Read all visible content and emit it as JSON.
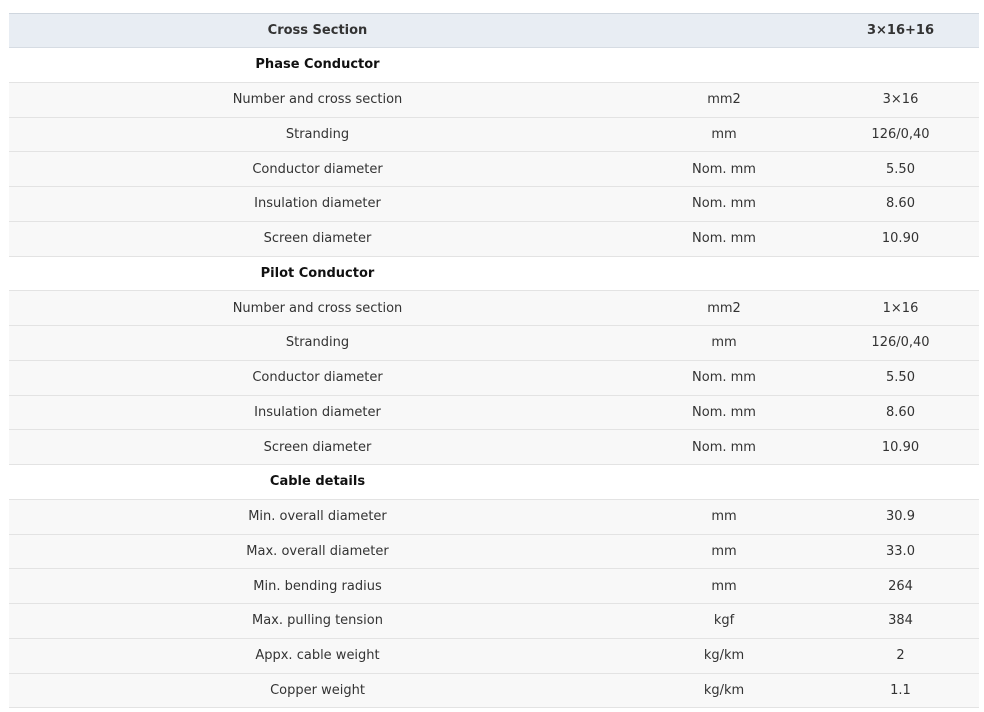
{
  "header": {
    "label": "Cross Section",
    "value": "3×16+16"
  },
  "sections": [
    {
      "title": "Phase Conductor",
      "rows": [
        {
          "name": "Number and cross section",
          "unit": "mm2",
          "value": "3×16"
        },
        {
          "name": "Stranding",
          "unit": "mm",
          "value": "126/0,40"
        },
        {
          "name": "Conductor diameter",
          "unit": "Nom. mm",
          "value": "5.50"
        },
        {
          "name": "Insulation diameter",
          "unit": "Nom. mm",
          "value": "8.60"
        },
        {
          "name": "Screen diameter",
          "unit": "Nom. mm",
          "value": "10.90"
        }
      ]
    },
    {
      "title": "Pilot Conductor",
      "rows": [
        {
          "name": "Number and cross section",
          "unit": "mm2",
          "value": "1×16"
        },
        {
          "name": "Stranding",
          "unit": "mm",
          "value": "126/0,40"
        },
        {
          "name": "Conductor diameter",
          "unit": "Nom. mm",
          "value": "5.50"
        },
        {
          "name": "Insulation diameter",
          "unit": "Nom. mm",
          "value": "8.60"
        },
        {
          "name": "Screen diameter",
          "unit": "Nom. mm",
          "value": "10.90"
        }
      ]
    },
    {
      "title": "Cable details",
      "rows": [
        {
          "name": "Min. overall diameter",
          "unit": "mm",
          "value": "30.9"
        },
        {
          "name": "Max. overall diameter",
          "unit": "mm",
          "value": "33.0"
        },
        {
          "name": "Min. bending radius",
          "unit": "mm",
          "value": "264"
        },
        {
          "name": "Max. pulling tension",
          "unit": "kgf",
          "value": "384"
        },
        {
          "name": "Appx. cable weight",
          "unit": "kg/km",
          "value": "2"
        },
        {
          "name": "Copper weight",
          "unit": "kg/km",
          "value": "1.1"
        }
      ]
    }
  ]
}
